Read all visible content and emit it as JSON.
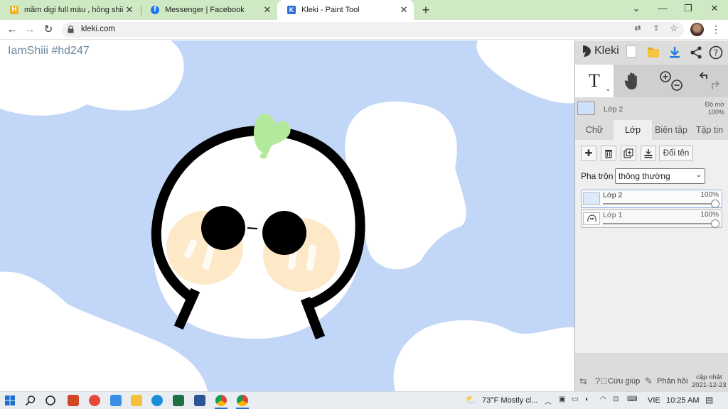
{
  "browser": {
    "tabs": [
      {
        "title": "mầm digi full màu , hông shiii , đ",
        "favicon_color": "#f2b01e",
        "favicon_letter": "H"
      },
      {
        "title": "Messenger | Facebook",
        "favicon_color": "#1877f2",
        "favicon_letter": "f"
      },
      {
        "title": "Kleki - Paint Tool",
        "favicon_color": "#2d6fd6",
        "favicon_letter": "K",
        "active": true
      }
    ],
    "url": "kleki.com"
  },
  "canvas": {
    "watermark": "IamShiii #hd247",
    "background_color": "#c2d7f7"
  },
  "kleki": {
    "logo": "Kleki",
    "tools": [
      "text-tool",
      "hand-tool",
      "zoom-tool",
      "undo-redo"
    ],
    "text_tool_glyph": "T",
    "current_layer": {
      "name": "Lớp 2",
      "opacity_label": "Độ mờ",
      "opacity_value": "100%"
    },
    "tabs": [
      "Chữ",
      "Lớp",
      "Biên tập",
      "Tập tin"
    ],
    "active_tab": "Lớp",
    "rename_label": "Đổi tên",
    "blend_label": "Pha trộn",
    "blend_value": "thông thường",
    "layers": [
      {
        "name": "Lớp 2",
        "opacity": "100%",
        "opacity_value": 1.0,
        "selected": true
      },
      {
        "name": "Lớp 1",
        "opacity": "100%",
        "opacity_value": 1.0,
        "selected": false
      }
    ],
    "footer": {
      "help_label": "Cứu giúp",
      "feedback_label": "Phản hồi",
      "update_label": "cập nhật",
      "update_date": "2021-12-23"
    }
  },
  "taskbar": {
    "weather": "73°F  Mostly cl...",
    "language": "VIE",
    "time": "10:25 AM"
  }
}
